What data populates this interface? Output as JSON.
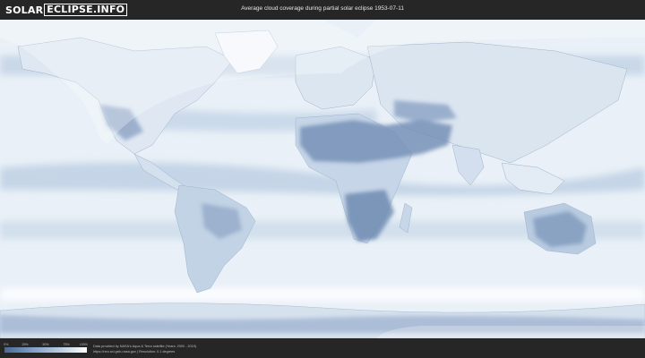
{
  "logo": {
    "part1": "SOLAR",
    "part2": "ECLIPSE.INFO"
  },
  "title": "Average cloud coverage during partial solar eclipse 1953-07-11",
  "legend": {
    "ticks": [
      "0%",
      "25%",
      "50%",
      "75%",
      "100%"
    ],
    "colors": {
      "low": "#4a6a96",
      "mid": "#b8cbe0",
      "high": "#ffffff"
    }
  },
  "credit": {
    "line1": "Data provided by NASA's Aqua & Terra satellite (Years: 2000 - 2019)",
    "line2": "https://neo.sci.gsfc.nasa.gov | Resolution: 0.1 degrees"
  }
}
